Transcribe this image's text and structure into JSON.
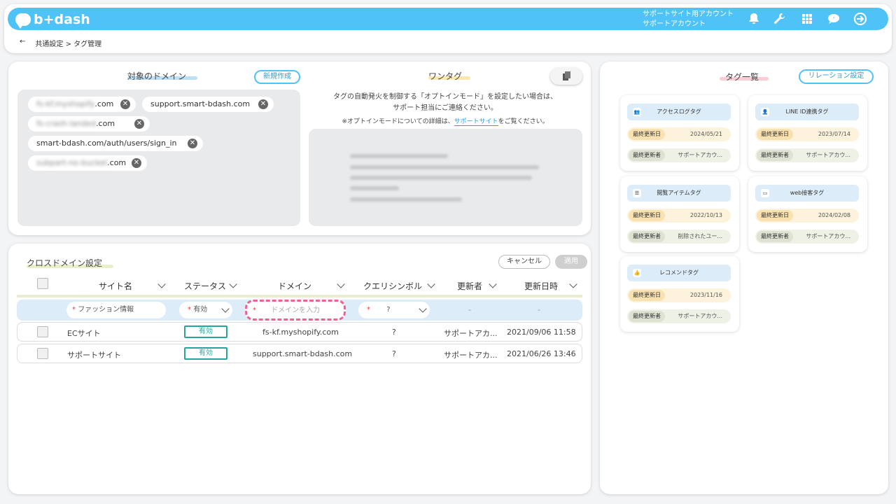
{
  "header": {
    "logo": "b+dash",
    "account_line1": "サポートサイト用アカウント",
    "account_line2": "サポートアカウント"
  },
  "breadcrumb": {
    "back": "←",
    "path": "共通設定 > タグ管理"
  },
  "domain_section": {
    "title": "対象のドメイン",
    "new_button": "新規作成",
    "chips": [
      {
        "blurred": "fs-kf.myshopify",
        "suffix": ".com"
      },
      {
        "blurred": "",
        "suffix": "support.smart-bdash.com"
      },
      {
        "blurred": "fs-crash-landed",
        "suffix": ".com"
      },
      {
        "blurred": "",
        "suffix": "smart-bdash.com/auth/users/sign_in"
      },
      {
        "blurred": "subpart-no-bucket",
        "suffix": ".com"
      }
    ]
  },
  "onetag": {
    "title": "ワンタグ",
    "note_line1": "タグの自動発火を制御する「オプトインモード」を設定したい場合は、",
    "note_line2": "サポート担当にご連絡ください。",
    "detail_pre": "※オプトインモードについての詳細は、",
    "detail_link": "サポートサイト",
    "detail_post": "をご覧ください。"
  },
  "crossdomain": {
    "title": "クロスドメイン設定",
    "cancel": "キャンセル",
    "apply": "適用",
    "columns": [
      "サイト名",
      "ステータス",
      "ドメイン",
      "クエリシンボル",
      "更新者",
      "更新日時"
    ],
    "new_row": {
      "site_value": "ファッション情報",
      "status_value": "有効",
      "domain_placeholder": "ドメインを入力",
      "query_value": "?",
      "updater": "-",
      "updated": "-"
    },
    "rows": [
      {
        "site": "ECサイト",
        "status": "有効",
        "domain": "fs-kf.myshopify.com",
        "query": "?",
        "updater": "サポートアカ...",
        "updated": "2021/09/06 11:58"
      },
      {
        "site": "サポートサイト",
        "status": "有効",
        "domain": "support.smart-bdash.com",
        "query": "?",
        "updater": "サポートアカ...",
        "updated": "2021/06/26 13:46"
      }
    ]
  },
  "tags": {
    "title": "タグ一覧",
    "relation_button": "リレーション設定",
    "label_updated": "最終更新日",
    "label_updater": "最終更新者",
    "items": [
      {
        "name": "アクセスログタグ",
        "date": "2024/05/21",
        "updater": "サポートアカウ..."
      },
      {
        "name": "LINE ID連携タグ",
        "date": "2023/07/14",
        "updater": "サポートアカウ..."
      },
      {
        "name": "閲覧アイテムタグ",
        "date": "2022/10/13",
        "updater": "削除されたユー..."
      },
      {
        "name": "web接客タグ",
        "date": "2024/02/08",
        "updater": "サポートアカウ..."
      },
      {
        "name": "レコメンドタグ",
        "date": "2023/11/16",
        "updater": "サポートアカウ..."
      }
    ]
  },
  "colors": {
    "accent": "#4fc3f7",
    "status": "#26a69a",
    "required": "#e53935",
    "highlight": "#f06292"
  }
}
